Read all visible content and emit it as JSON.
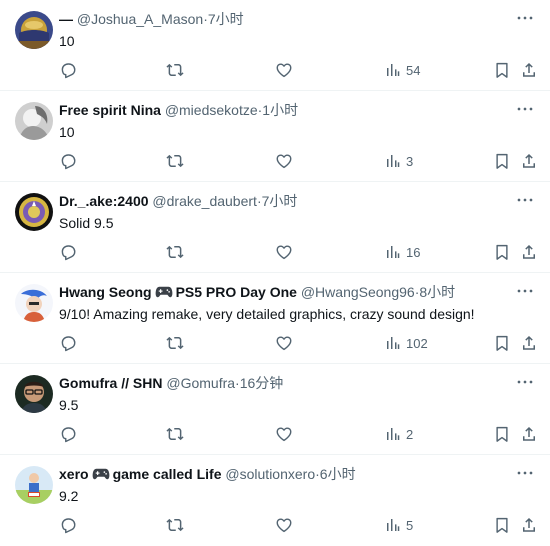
{
  "colors": {
    "text": "#0f1419",
    "muted": "#536471",
    "border": "#eff3f4"
  },
  "tweets": [
    {
      "name": "—",
      "handle": "@Joshua_A_Mason",
      "time": "7小时",
      "text": "10",
      "views": "54",
      "avatar": "avatar-planet"
    },
    {
      "name": "Free spirit Nina",
      "handle": "@miedsekotze",
      "time": "1小时",
      "text": "10",
      "views": "3",
      "avatar": "avatar-bw-portrait"
    },
    {
      "name": "Dr._.ake:2400",
      "handle": "@drake_daubert",
      "time": "7小时",
      "text": "Solid 9.5",
      "views": "16",
      "avatar": "avatar-badge"
    },
    {
      "name_pre": "Hwang Seong",
      "name_post": "PS5 PRO Day One",
      "handle": "@HwangSeong96",
      "time": "8小时",
      "text": "9/10! Amazing remake, very detailed graphics, crazy sound design!",
      "views": "102",
      "avatar": "avatar-anime"
    },
    {
      "name": "Gomufra // SHN",
      "handle": "@Gomufra",
      "time": "16分钟",
      "text": "9.5",
      "views": "2",
      "avatar": "avatar-glasses-man"
    },
    {
      "name_pre": "xero",
      "name_post": "game called Life",
      "handle": "@solutionxero",
      "time": "6小时",
      "text": "9.2",
      "views": "5",
      "avatar": "avatar-character"
    }
  ],
  "separator": "·"
}
